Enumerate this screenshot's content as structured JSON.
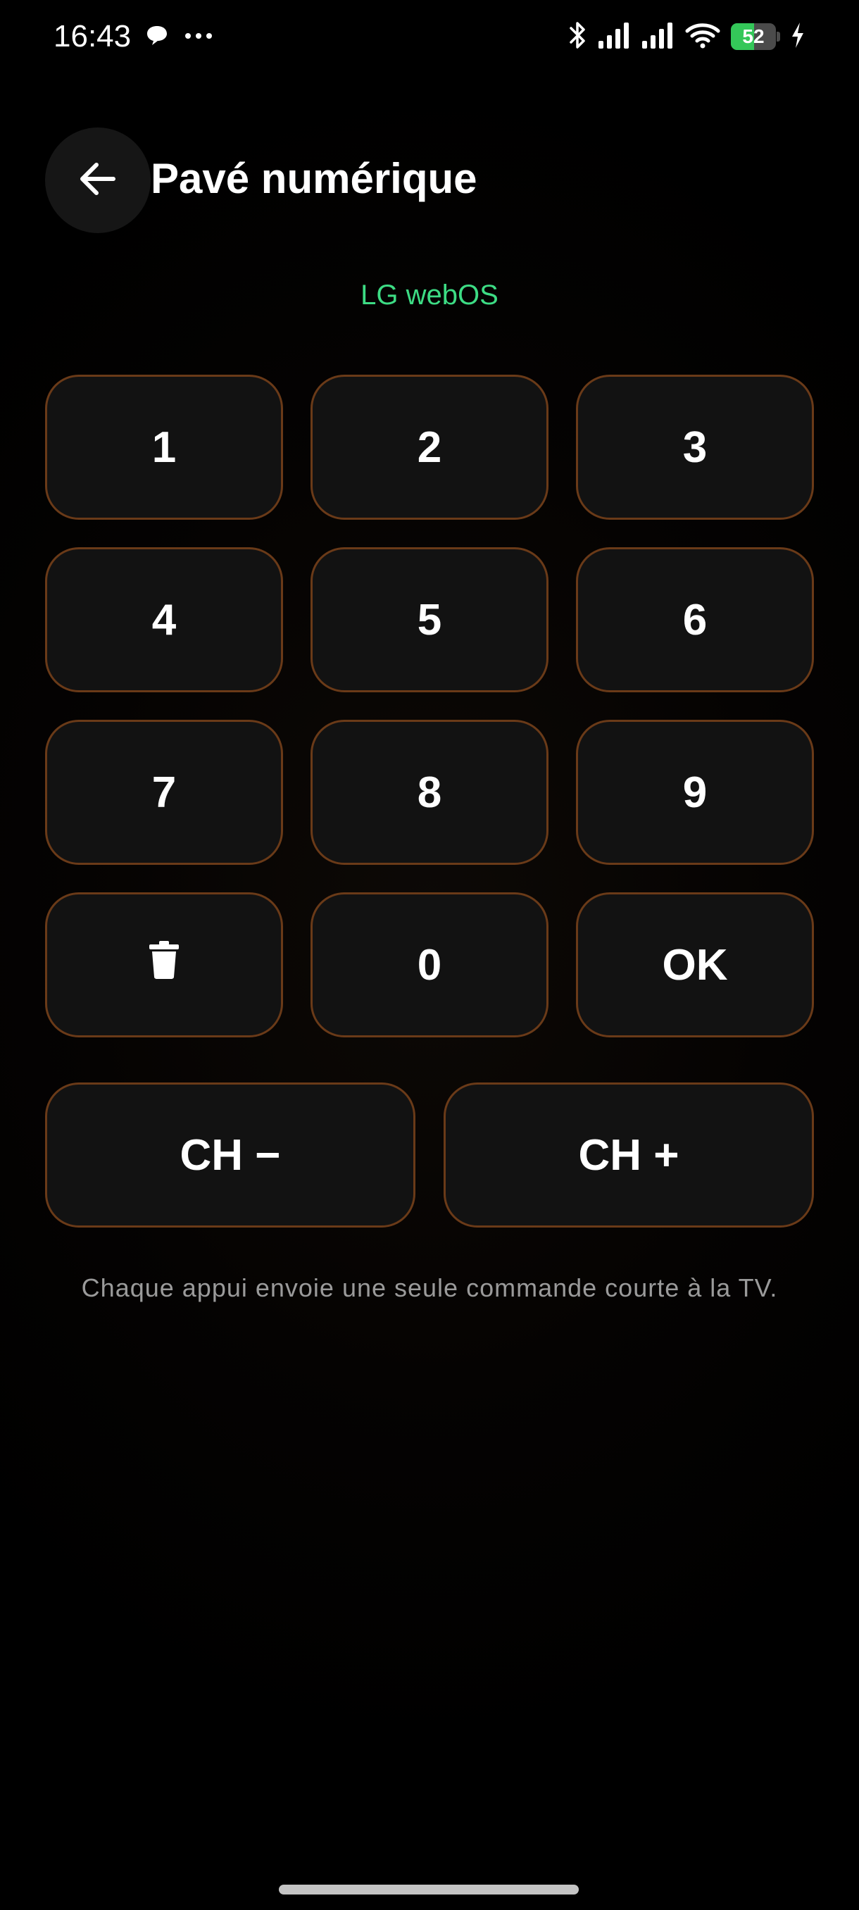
{
  "status_bar": {
    "time": "16:43",
    "battery_level": "52",
    "battery_fraction": 0.52,
    "battery_color": "#34c759",
    "icons_left": [
      "chat-bubble-icon",
      "more-dots-icon"
    ],
    "icons_right": [
      "bluetooth-icon",
      "cell-signal-icon",
      "cell-signal-icon",
      "wifi-icon",
      "charging-bolt-icon"
    ]
  },
  "header": {
    "back_icon": "arrow-left-icon",
    "title": "Pavé numérique"
  },
  "device": {
    "name": "LG webOS",
    "color": "#3ddc84"
  },
  "keypad": {
    "key_1": "1",
    "key_2": "2",
    "key_3": "3",
    "key_4": "4",
    "key_5": "5",
    "key_6": "6",
    "key_7": "7",
    "key_8": "8",
    "key_9": "9",
    "delete_icon": "trash-icon",
    "key_0": "0",
    "ok": "OK",
    "channel_down": "CH −",
    "channel_up": "CH +",
    "border_color": "#6a3a18"
  },
  "hint": "Chaque appui envoie une seule commande courte à la TV."
}
